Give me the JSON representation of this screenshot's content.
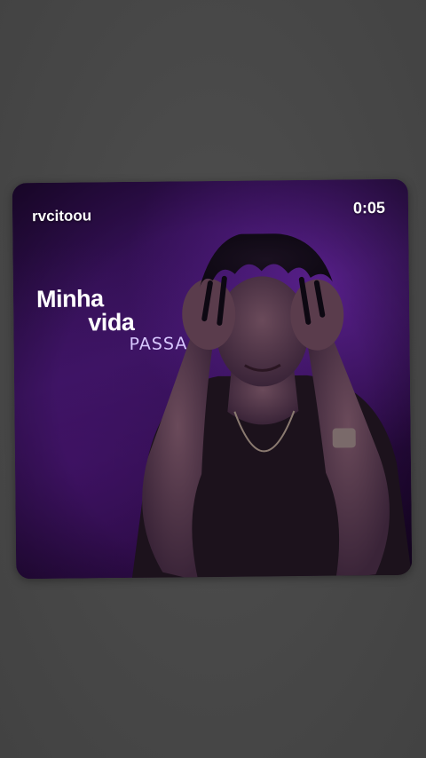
{
  "post": {
    "username": "rvcitoou",
    "elapsed": "0:05"
  },
  "lyrics": {
    "line1": "Minha",
    "line2": "vida",
    "line3": "PASSA"
  },
  "colors": {
    "page_background": "#4a4a4a",
    "card_purple": "#3a1460",
    "lyric_accent": "#d8c8ff"
  }
}
